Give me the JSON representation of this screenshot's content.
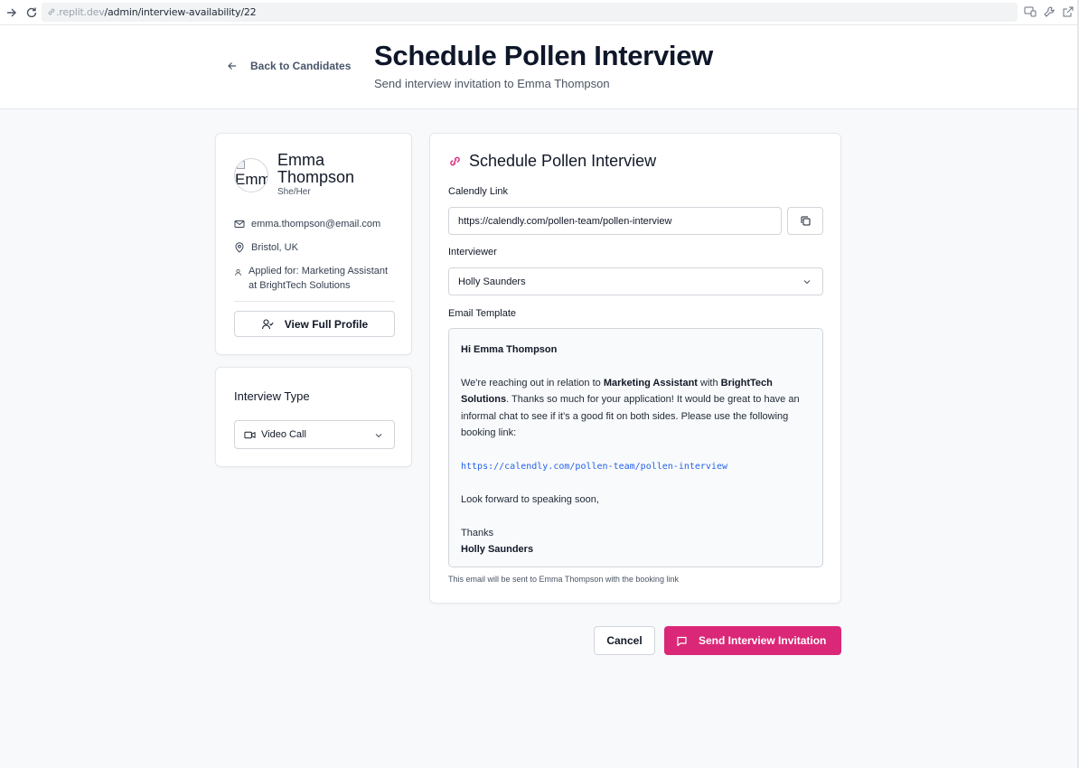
{
  "browser": {
    "url_prefix": ".replit.dev",
    "url_path": "/admin/interview-availability/22"
  },
  "header": {
    "back_label": "Back to Candidates",
    "title": "Schedule Pollen Interview",
    "subtitle": "Send interview invitation to Emma Thompson"
  },
  "candidate": {
    "avatar_alt": "Emma",
    "name": "Emma Thompson",
    "pronouns": "She/Her",
    "email": "emma.thompson@email.com",
    "location": "Bristol, UK",
    "applied_for": "Applied for: Marketing Assistant at BrightTech Solutions",
    "view_profile_label": "View Full Profile"
  },
  "interview_type": {
    "title": "Interview Type",
    "selected": "Video Call"
  },
  "schedule": {
    "title": "Schedule Pollen Interview",
    "calendly_label": "Calendly Link",
    "calendly_value": "https://calendly.com/pollen-team/pollen-interview",
    "interviewer_label": "Interviewer",
    "interviewer_selected": "Holly Saunders",
    "template_label": "Email Template",
    "note": "This email will be sent to Emma Thompson with the booking link"
  },
  "email": {
    "greeting": "Hi Emma Thompson",
    "p1_a": "We're reaching out in relation to ",
    "p1_role": "Marketing Assistant",
    "p1_b": " with ",
    "p1_company": "BrightTech Solutions",
    "p1_c": ". Thanks so much for your application! It would be great to have an informal chat to see if it's a good fit on both sides. Please use the following booking link:",
    "link": "https://calendly.com/pollen-team/pollen-interview",
    "closing": "Look forward to speaking soon,",
    "thanks": "Thanks",
    "signature": "Holly Saunders"
  },
  "actions": {
    "cancel_label": "Cancel",
    "send_label": "Send Interview Invitation"
  },
  "colors": {
    "accent": "#db2777",
    "link": "#2563eb"
  }
}
